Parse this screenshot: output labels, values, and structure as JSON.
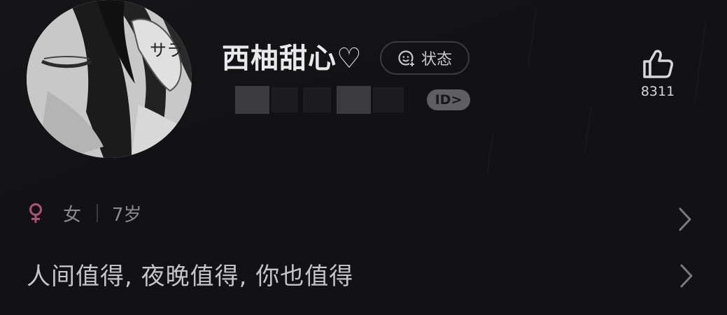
{
  "profile": {
    "name": "西柚甜心♡",
    "status_label": "状态",
    "id_badge": "ID>",
    "likes": "8311",
    "gender": "女",
    "age": "7岁",
    "bio": "人间值得,  夜晚值得,  你也值得"
  },
  "icons": {
    "status": "smiley-plus-icon",
    "like": "thumbs-up-icon",
    "gender": "female-icon",
    "chevron": "chevron-right-icon"
  },
  "colors": {
    "background": "#121215",
    "female_accent": "#b0537a",
    "badge": "#5f5f63"
  }
}
